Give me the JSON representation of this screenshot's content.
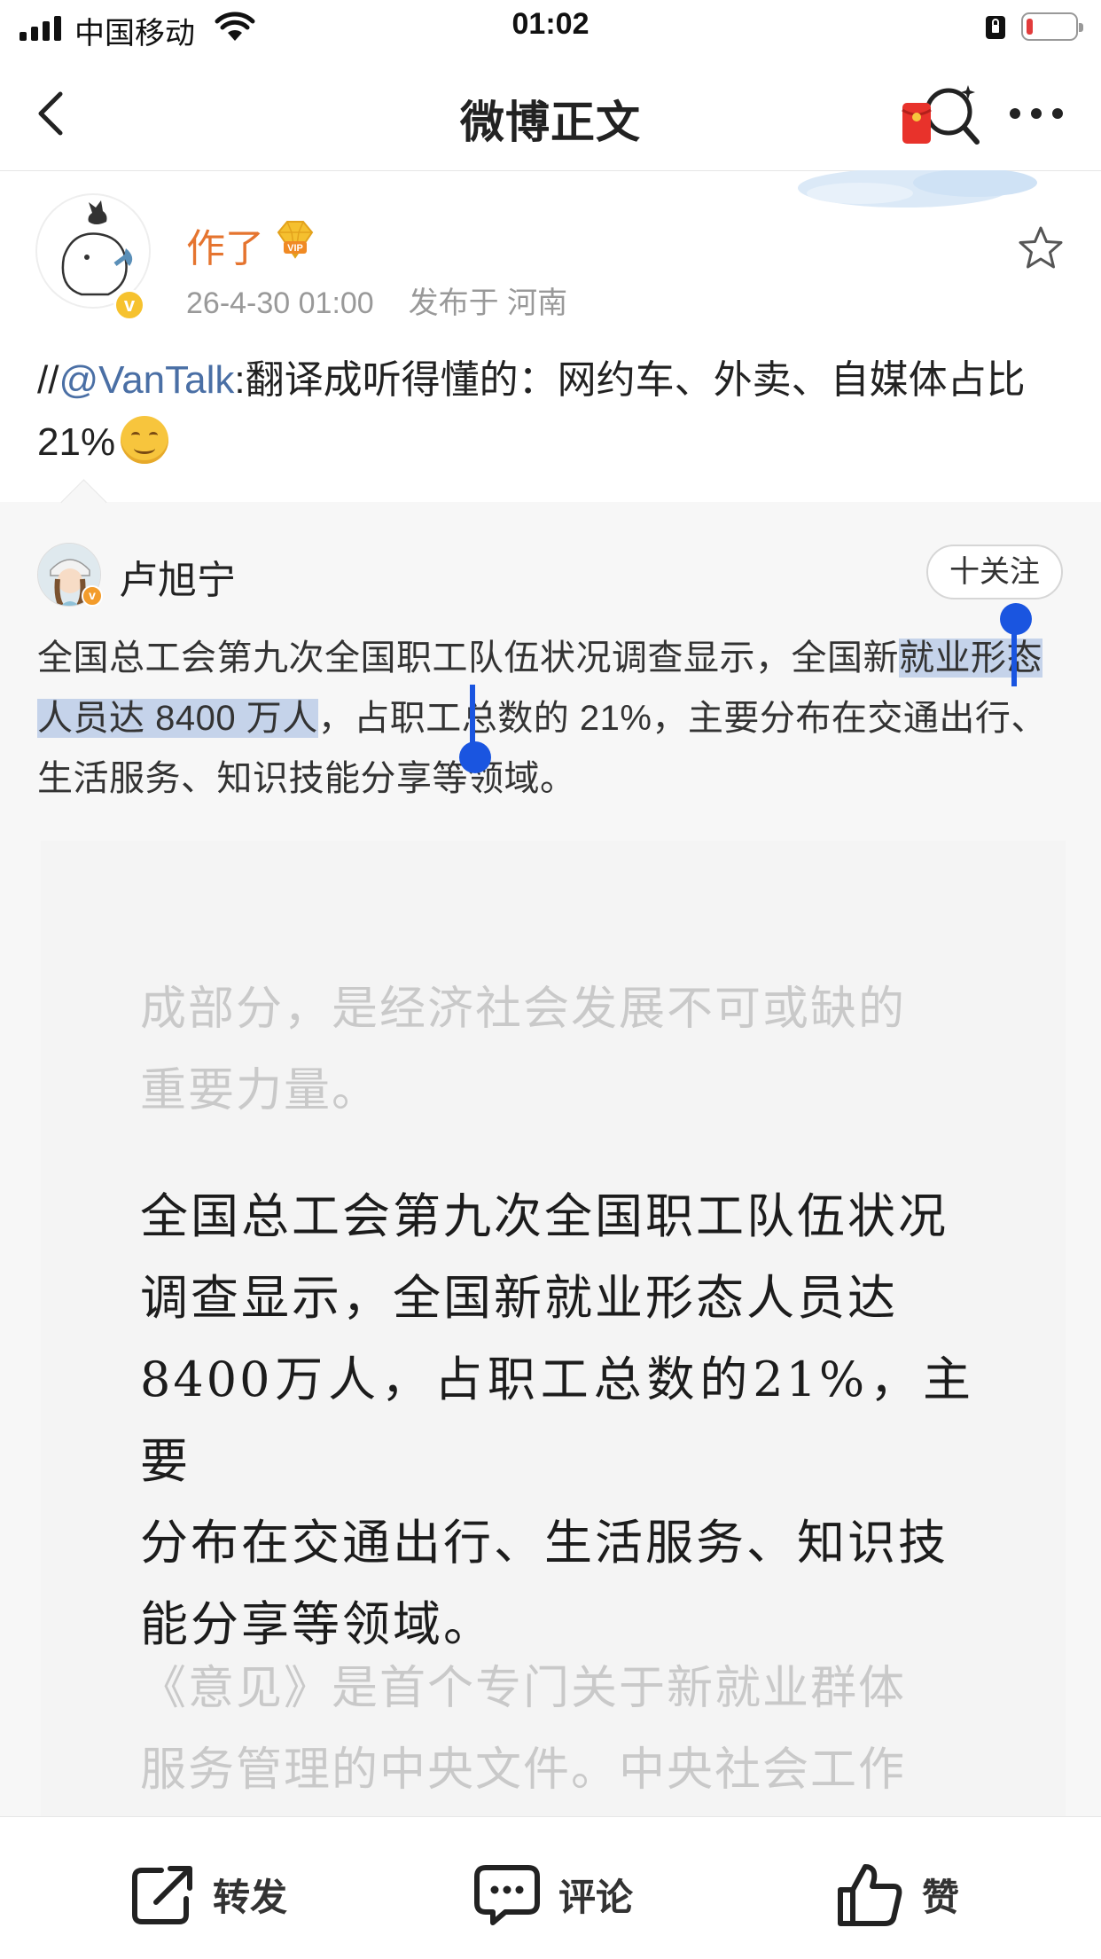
{
  "status_bar": {
    "carrier": "中国移动",
    "time": "01:02"
  },
  "nav": {
    "title": "微博正文"
  },
  "post": {
    "username": "作了",
    "timestamp": "26-4-30 01:00",
    "location": "发布于 河南",
    "text_prefix": "//",
    "mention": "@VanTalk",
    "text_body": ":翻译成听得懂的：网约车、外卖、自媒体占比 21%"
  },
  "repost": {
    "author": "卢旭宁",
    "follow_label": "十关注",
    "text_before": "全国总工会第九次全国职工队伍状况调查显示，全国新",
    "text_selected": "就业形态人员达 8400 万人",
    "text_after": "，占职工总数的 21%，主要分布在交通出行、生活服务、知识技能分享等领域。"
  },
  "embed_image": {
    "faded_top_1": "成部分，是经济社会发展不可或缺的",
    "faded_top_2": "重要力量。",
    "main_1": "全国总工会第九次全国职工队伍状况",
    "main_2": "调查显示，全国新就业形态人员达",
    "main_3": "8400万人，占职工总数的21%，主要",
    "main_4": "分布在交通出行、生活服务、知识技",
    "main_5": "能分享等领域。",
    "faded_bottom_1": "《意见》是首个专门关于新就业群体",
    "faded_bottom_2": "服务管理的中央文件。中央社会工作"
  },
  "toolbar": {
    "repost_label": "转发",
    "comment_label": "评论",
    "like_label": "赞"
  },
  "icons": {
    "back": "chevron-left-icon",
    "red_packet_search": "red-packet-search-icon",
    "more": "more-dots-icon",
    "favorite": "star-icon",
    "repost": "share-arrow-icon",
    "comment": "speech-bubble-icon",
    "like": "thumbs-up-icon"
  },
  "colors": {
    "username": "#e5742f",
    "mention": "#4a6fa5",
    "selection": "#c5d3ea",
    "selection_handle": "#1a55e0",
    "battery_low": "#e23b3b"
  }
}
